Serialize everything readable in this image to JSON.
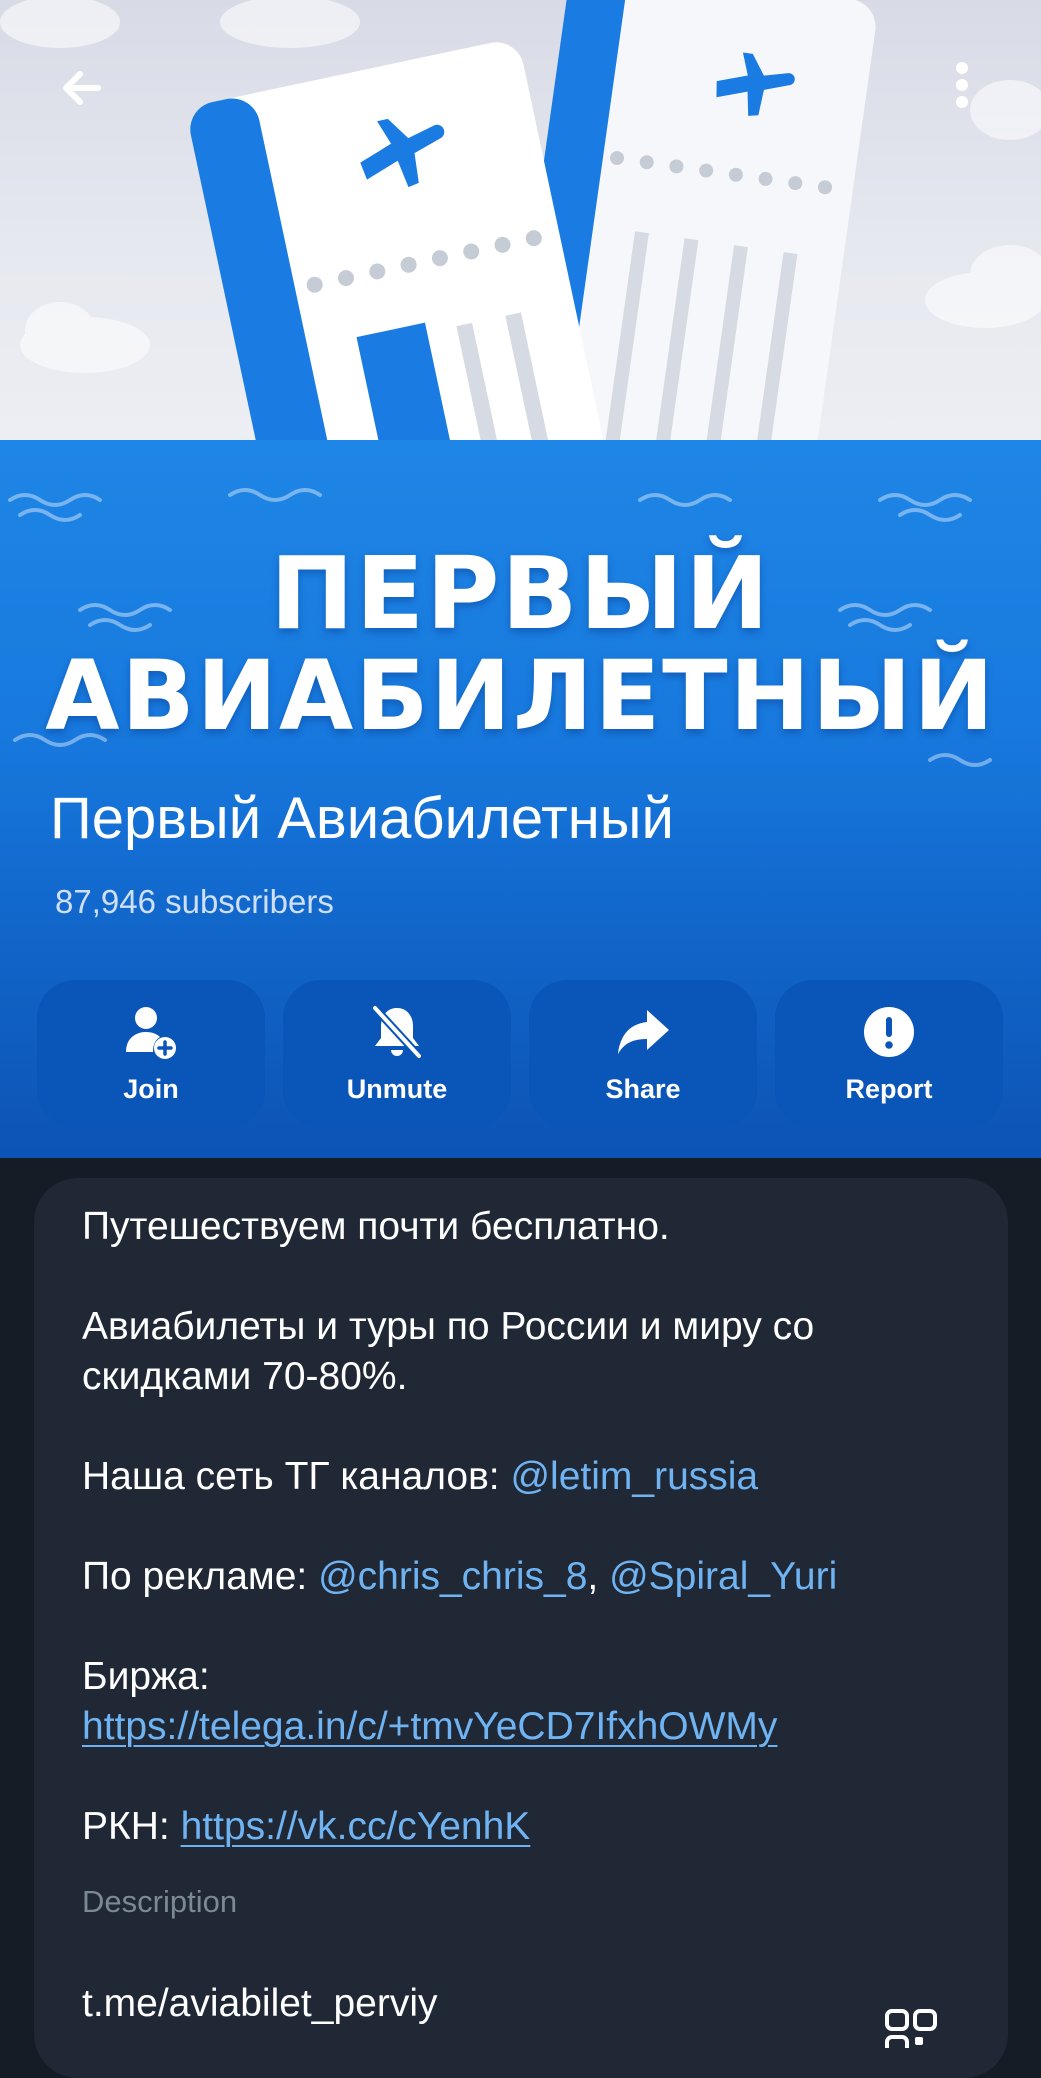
{
  "banner": {
    "line1": "ПЕРВЫЙ",
    "line2": "АВИАБИЛЕТНЫЙ"
  },
  "header": {
    "back_icon": "arrow-left-icon",
    "more_icon": "more-vertical-icon"
  },
  "channel": {
    "title": "Первый Авиабилетный",
    "subscribers": "87,946 subscribers"
  },
  "actions": [
    {
      "label": "Join",
      "icon": "add-user-icon"
    },
    {
      "label": "Unmute",
      "icon": "bell-off-icon"
    },
    {
      "label": "Share",
      "icon": "share-arrow-icon"
    },
    {
      "label": "Report",
      "icon": "exclamation-circle-icon"
    }
  ],
  "description": {
    "line1": "Путешествуем почти бесплатно.",
    "line2": "Авиабилеты и туры по России и миру со скидками 70-80%.",
    "network_prefix": "Наша сеть ТГ каналов: ",
    "network_link": "@letim_russia",
    "ads_prefix": "По рекламе: ",
    "ads_link1": "@chris_chris_8",
    "ads_sep": ", ",
    "ads_link2": "@Spiral_Yuri",
    "exchange_label": "Биржа:",
    "exchange_link": "https://telega.in/c/+tmvYeCD7IfxhOWMy",
    "rkn_prefix": "РКН: ",
    "rkn_link": "https://vk.cc/cYenhK",
    "label": "Description"
  },
  "link": {
    "value": "t.me/aviabilet_perviy",
    "qr_icon": "qr-code-icon"
  },
  "colors": {
    "banner_blue": "#1877dc",
    "button_blue": "#0a55b8",
    "card_bg": "#1f2834",
    "page_bg": "#141c25",
    "link": "#6fb3f2"
  }
}
